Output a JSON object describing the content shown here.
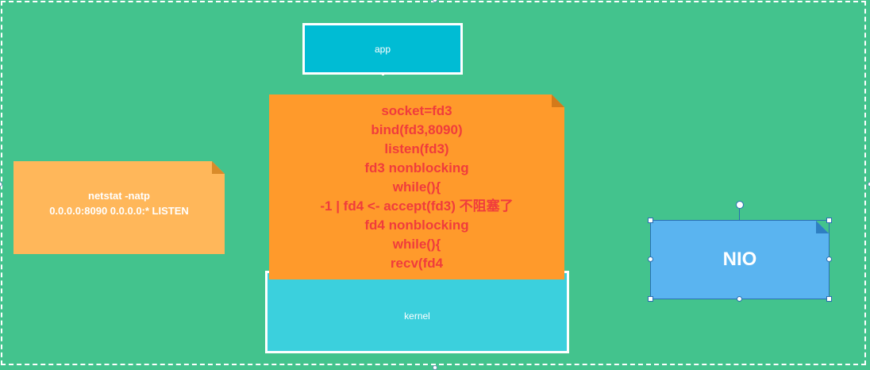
{
  "diagram": {
    "app_label": "app",
    "kernel_label": "kernel",
    "code_lines": [
      "socket=fd3",
      "bind(fd3,8090)",
      "listen(fd3)",
      "fd3  nonblocking",
      "while(){",
      "-1 | fd4 <-  accept(fd3)  不阻塞了",
      "fd4 nonblocking",
      "while(){",
      "recv(fd4"
    ],
    "netstat_lines": [
      "netstat -natp",
      "0.0.0.0:8090  0.0.0.0:*  LISTEN"
    ],
    "nio_label": "NIO"
  },
  "colors": {
    "canvas": "#43c38d",
    "app_fill": "#00bcd4",
    "kernel_fill": "#3bd0dd",
    "code_note_fill": "#ff9a2b",
    "code_text": "#f03c3c",
    "netstat_note_fill": "#ffb75a",
    "nio_note_fill": "#5ab4f0",
    "selection": "#2b6fb3"
  }
}
